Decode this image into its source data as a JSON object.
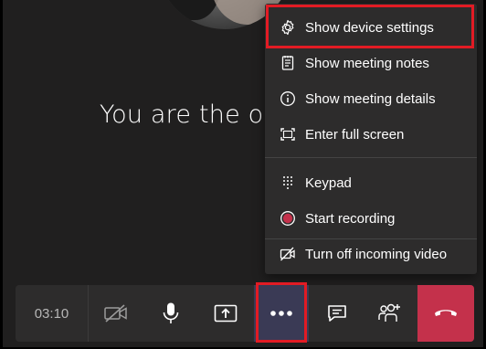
{
  "stage": {
    "status_text": "You are the on"
  },
  "menu": {
    "items": [
      {
        "label": "Show device settings",
        "icon": "gear-icon"
      },
      {
        "label": "Show meeting notes",
        "icon": "notes-icon"
      },
      {
        "label": "Show meeting details",
        "icon": "info-icon"
      },
      {
        "label": "Enter full screen",
        "icon": "fullscreen-icon"
      },
      {
        "label": "Keypad",
        "icon": "keypad-icon"
      },
      {
        "label": "Start recording",
        "icon": "record-icon"
      },
      {
        "label": "Turn off incoming video",
        "icon": "video-off-icon"
      }
    ]
  },
  "controls": {
    "timer": "03:10",
    "buttons": [
      {
        "name": "camera-off",
        "icon": "camera-off-icon"
      },
      {
        "name": "microphone",
        "icon": "microphone-icon"
      },
      {
        "name": "share",
        "icon": "share-icon"
      },
      {
        "name": "more-actions",
        "icon": "ellipsis-icon"
      },
      {
        "name": "chat",
        "icon": "chat-icon"
      },
      {
        "name": "participants",
        "icon": "participants-icon"
      },
      {
        "name": "hang-up",
        "icon": "hangup-icon"
      }
    ]
  },
  "colors": {
    "background": "#201f1f",
    "panel": "#2d2c2c",
    "hangup": "#c4314b",
    "highlight": "#e21b24",
    "record": "#c4314b"
  }
}
